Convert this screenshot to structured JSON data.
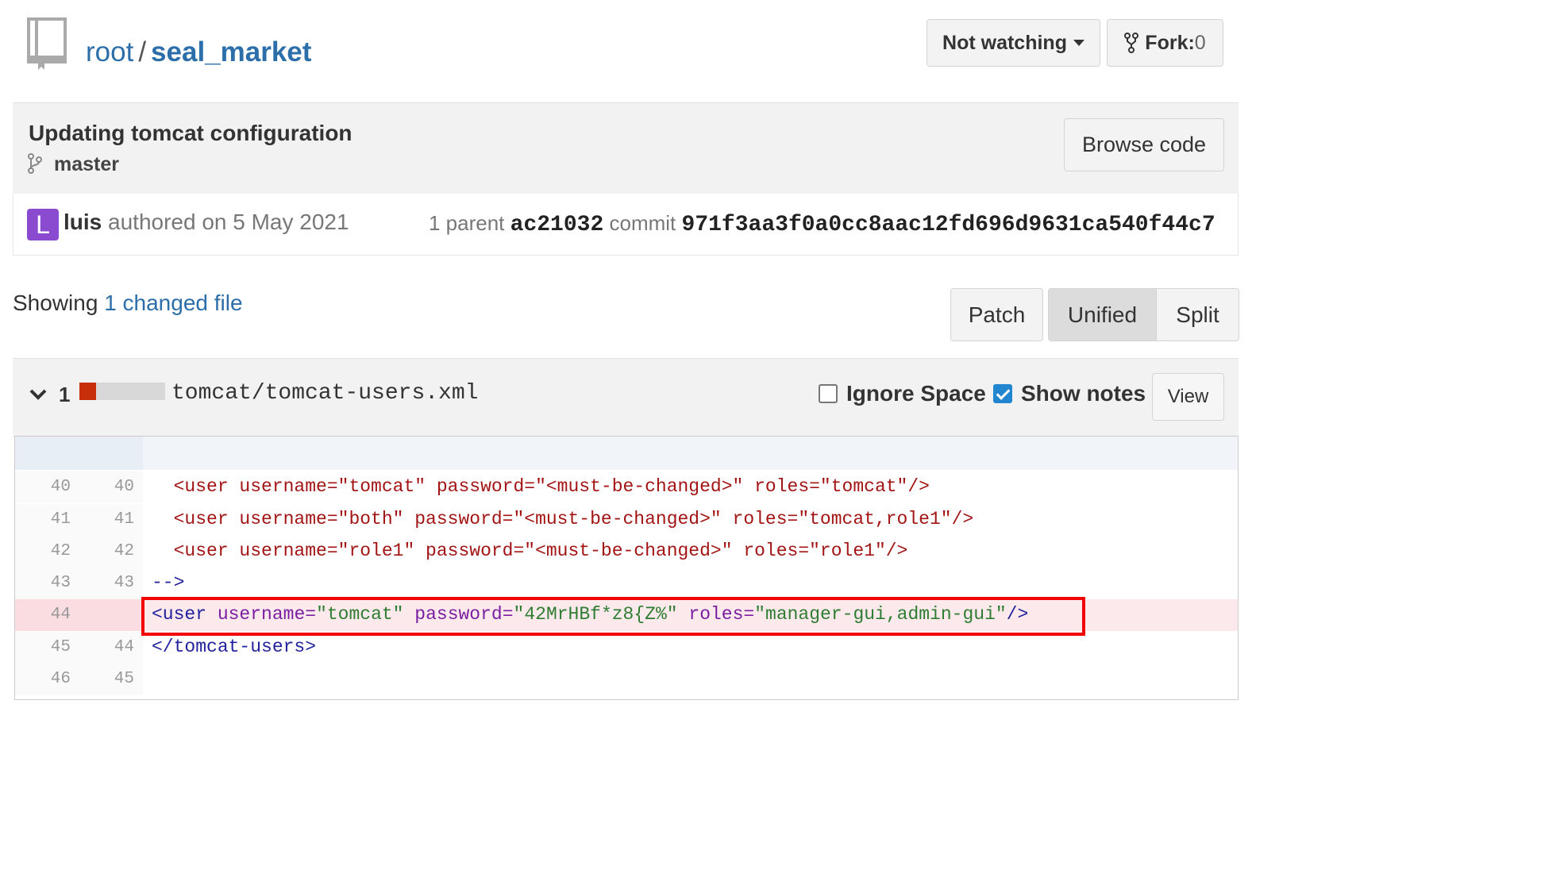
{
  "header": {
    "owner": "root",
    "separator": "/",
    "repo": "seal_market",
    "watch_label": "Not watching",
    "fork_label": "Fork:",
    "fork_count": "0"
  },
  "commit": {
    "title": "Updating tomcat configuration",
    "branch": "master",
    "browse_label": "Browse code",
    "avatar_letter": "L",
    "author": "luis",
    "authored_text": "authored on 5 May 2021",
    "parent_label": "1 parent",
    "parent_sha": "ac21032",
    "commit_label": "commit",
    "commit_sha": "971f3aa3f0a0cc8aac12fd696d9631ca540f44c7"
  },
  "summary": {
    "showing": "Showing",
    "changed_link": "1 changed file"
  },
  "view_modes": {
    "patch": "Patch",
    "unified": "Unified",
    "split": "Split",
    "active": "Unified"
  },
  "file": {
    "count": "1",
    "path": "tomcat/tomcat-users.xml",
    "ignore_space": "Ignore Space",
    "show_notes": "Show notes",
    "view_label": "View",
    "ignore_space_checked": false,
    "show_notes_checked": true
  },
  "diff": {
    "lines": [
      {
        "old": "40",
        "new": "40",
        "text": "  <user username=\"tomcat\" password=\"<must-be-changed>\" roles=\"tomcat\"/>",
        "type": "context"
      },
      {
        "old": "41",
        "new": "41",
        "text": "  <user username=\"both\" password=\"<must-be-changed>\" roles=\"tomcat,role1\"/>",
        "type": "context"
      },
      {
        "old": "42",
        "new": "42",
        "text": "  <user username=\"role1\" password=\"<must-be-changed>\" roles=\"role1\"/>",
        "type": "context"
      },
      {
        "old": "43",
        "new": "43",
        "text": "-->",
        "type": "context"
      },
      {
        "old": "44",
        "new": "",
        "type": "deleted",
        "parts": {
          "open": "<user",
          "a1": "username=",
          "v1": "\"tomcat\"",
          "a2": "password=",
          "v2": "\"42MrHBf*z8{Z%\"",
          "a3": "roles=",
          "v3": "\"manager-gui,admin-gui\"",
          "close": "/>"
        }
      },
      {
        "old": "45",
        "new": "44",
        "text": "</tomcat-users>",
        "type": "context"
      },
      {
        "old": "46",
        "new": "45",
        "text": "",
        "type": "context"
      }
    ]
  },
  "colors": {
    "link": "#2c6eaa",
    "avatar": "#8a4bd0",
    "deleted_row": "#fbe9eb",
    "highlight_box": "#f20000",
    "diffstat_removed": "#c72e0a"
  }
}
